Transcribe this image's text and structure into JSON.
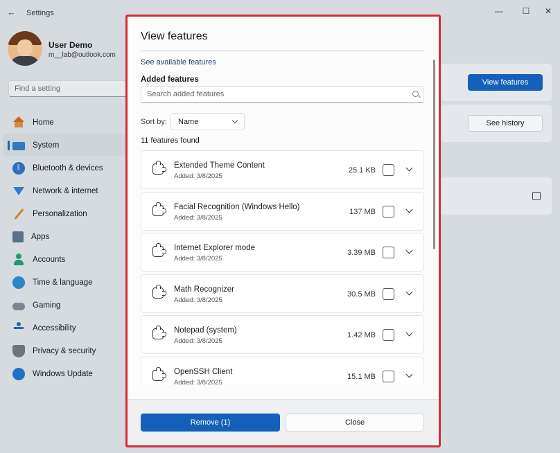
{
  "window": {
    "title": "Settings",
    "back_icon": "back-arrow-icon",
    "controls": [
      "—",
      "☐",
      "✕"
    ]
  },
  "user": {
    "name": "User Demo",
    "email": "m__lab@outlook.com"
  },
  "search": {
    "placeholder": "Find a setting"
  },
  "sidebar": {
    "items": [
      {
        "label": "Home",
        "icon": "home-icon"
      },
      {
        "label": "System",
        "icon": "system-icon",
        "active": true
      },
      {
        "label": "Bluetooth & devices",
        "icon": "bluetooth-icon"
      },
      {
        "label": "Network & internet",
        "icon": "network-icon"
      },
      {
        "label": "Personalization",
        "icon": "personalization-icon"
      },
      {
        "label": "Apps",
        "icon": "apps-icon"
      },
      {
        "label": "Accounts",
        "icon": "accounts-icon"
      },
      {
        "label": "Time & language",
        "icon": "time-icon"
      },
      {
        "label": "Gaming",
        "icon": "gaming-icon"
      },
      {
        "label": "Accessibility",
        "icon": "accessibility-icon"
      },
      {
        "label": "Privacy & security",
        "icon": "privacy-icon"
      },
      {
        "label": "Windows Update",
        "icon": "update-icon"
      }
    ]
  },
  "background": {
    "view_features_label": "View features",
    "see_history_label": "See history"
  },
  "dialog": {
    "title": "View features",
    "see_available_link": "See available features",
    "added_heading": "Added features",
    "search_placeholder": "Search added features",
    "sort_label": "Sort by:",
    "sort_value": "Name",
    "found_count": "11 features found",
    "features": [
      {
        "name": "Extended Theme Content",
        "added": "Added: 3/8/2025",
        "size": "25.1 KB",
        "checked": false
      },
      {
        "name": "Facial Recognition (Windows Hello)",
        "added": "Added: 3/8/2025",
        "size": "137 MB",
        "checked": false
      },
      {
        "name": "Internet Explorer mode",
        "added": "Added: 3/8/2025",
        "size": "3.39 MB",
        "checked": false
      },
      {
        "name": "Math Recognizer",
        "added": "Added: 3/8/2025",
        "size": "30.5 MB",
        "checked": false
      },
      {
        "name": "Notepad (system)",
        "added": "Added: 3/8/2025",
        "size": "1.42 MB",
        "checked": false
      },
      {
        "name": "OpenSSH Client",
        "added": "Added: 3/8/2025",
        "size": "15.1 MB",
        "checked": false
      }
    ],
    "remove_label": "Remove (1)",
    "close_label": "Close"
  },
  "colors": {
    "accent": "#1560b8",
    "highlight_frame": "#d42b3a"
  }
}
